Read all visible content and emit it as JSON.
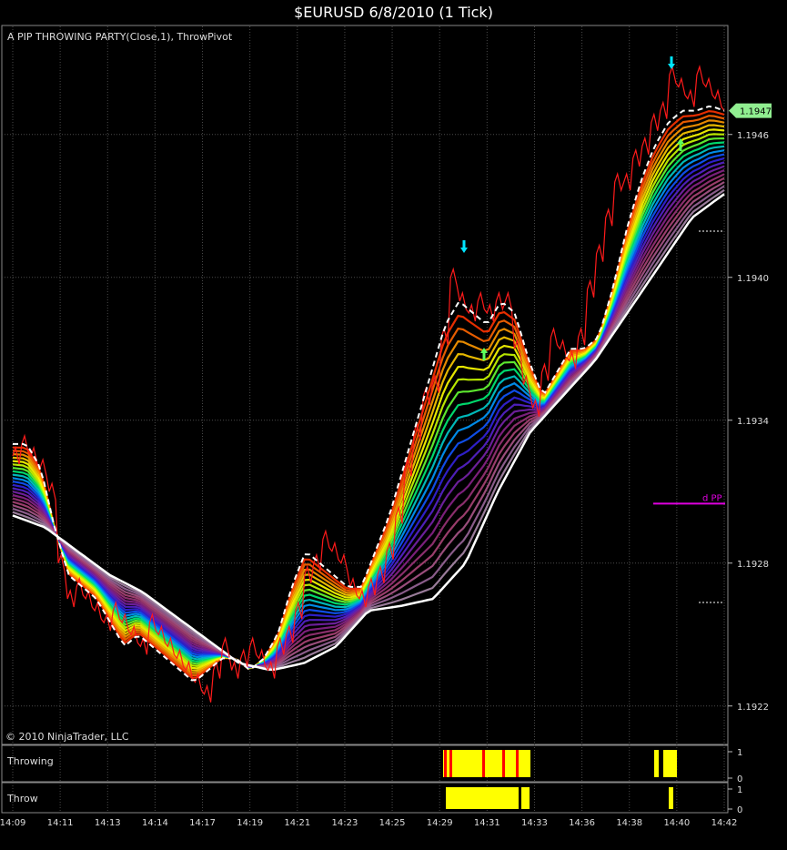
{
  "window": {
    "title": "$EURUSD  6/8/2010 (1 Tick)"
  },
  "indicator_label": "A PIP THROWING PARTY(Close,1), ThrowPivot",
  "copyright": "© 2010 NinjaTrader, LLC",
  "colors": {
    "background": "#000000",
    "grid": "#4a4a4a",
    "price": "#ff1a1a",
    "dashed_line": "#ffffff",
    "slow_line": "#ffffff",
    "pivot_line": "#e000e0",
    "last_price_label": "#90ee90",
    "arrow_down": "#00e5ff",
    "arrow_up": "#5cff5c",
    "histogram": "#ffff00",
    "histogram_alt": "#ff0000",
    "ribbon": [
      "#ff3300",
      "#ff6600",
      "#ff9900",
      "#ffcc00",
      "#ffff00",
      "#ccff00",
      "#66ff33",
      "#00ee77",
      "#00cccc",
      "#0099ff",
      "#1155ff",
      "#3322dd",
      "#5522cc",
      "#7722aa",
      "#882288",
      "#993377",
      "#aa4477",
      "#aa5588",
      "#996699",
      "#aa88aa"
    ]
  },
  "chart_data": {
    "type": "line",
    "x_tick_labels": [
      "14:09",
      "14:11",
      "14:13",
      "14:14",
      "14:17",
      "14:19",
      "14:21",
      "14:23",
      "14:25",
      "14:29",
      "14:31",
      "14:33",
      "14:36",
      "14:38",
      "14:40",
      "14:42"
    ],
    "y_tick_labels": [
      "1.1946",
      "1.1940",
      "1.1934",
      "1.1928",
      "1.1922"
    ],
    "ylim": [
      1.19205,
      1.19505
    ],
    "last_price": "1.1947",
    "pivot_label": "d PP",
    "pivot_value": 1.19305,
    "series": [
      {
        "name": "price",
        "values": [
          1.19325,
          1.1933,
          1.19325,
          1.1932,
          1.1931,
          1.1928,
          1.19265,
          1.1927,
          1.19265,
          1.1926,
          1.19255,
          1.1926,
          1.19255,
          1.1925,
          1.19245,
          1.19255,
          1.1925,
          1.19245,
          1.1924,
          1.19235,
          1.1923,
          1.19225,
          1.19235,
          1.19245,
          1.19235,
          1.1924,
          1.19245,
          1.1924,
          1.19235,
          1.19245,
          1.1925,
          1.1926,
          1.19275,
          1.1928,
          1.1929,
          1.19285,
          1.1928,
          1.1927,
          1.19265,
          1.1927,
          1.19275,
          1.19285,
          1.193,
          1.1932,
          1.19335,
          1.1935,
          1.19355,
          1.19375,
          1.194,
          1.1939,
          1.19385,
          1.1939,
          1.19385,
          1.1939,
          1.1939,
          1.1937,
          1.19355,
          1.19345,
          1.1936,
          1.19375,
          1.1937,
          1.19365,
          1.19375,
          1.19395,
          1.1941,
          1.19425,
          1.1944,
          1.1944,
          1.1945,
          1.19455,
          1.19465,
          1.1947,
          1.19485,
          1.1948,
          1.19475,
          1.19485,
          1.1948,
          1.19475,
          1.1947
        ]
      },
      {
        "name": "dashed",
        "values": [
          1.1933,
          1.1933,
          1.1932,
          1.19295,
          1.19275,
          1.1927,
          1.19265,
          1.19255,
          1.19245,
          1.1925,
          1.19245,
          1.1924,
          1.19235,
          1.1923,
          1.19235,
          1.1924,
          1.1924,
          1.19235,
          1.1924,
          1.1925,
          1.1927,
          1.19285,
          1.1928,
          1.19275,
          1.1927,
          1.1927,
          1.19285,
          1.193,
          1.1932,
          1.1934,
          1.1936,
          1.1938,
          1.1939,
          1.19385,
          1.1938,
          1.1939,
          1.19385,
          1.19365,
          1.1935,
          1.1936,
          1.1937,
          1.1937,
          1.19375,
          1.19395,
          1.1942,
          1.1944,
          1.19455,
          1.19465,
          1.1947,
          1.1947,
          1.19472,
          1.1947
        ]
      },
      {
        "name": "slow",
        "values": [
          1.193,
          1.19295,
          1.19285,
          1.19275,
          1.19268,
          1.19258,
          1.19248,
          1.19238,
          1.19235,
          1.19238,
          1.19245,
          1.1926,
          1.19262,
          1.19265,
          1.1928,
          1.1931,
          1.19335,
          1.1935,
          1.19365,
          1.19385,
          1.19405,
          1.19425,
          1.19435
        ]
      }
    ],
    "panels": [
      {
        "name": "Throwing",
        "yticks": [
          "1",
          "0"
        ]
      },
      {
        "name": "Throw",
        "yticks": [
          "1",
          "0"
        ]
      }
    ]
  }
}
